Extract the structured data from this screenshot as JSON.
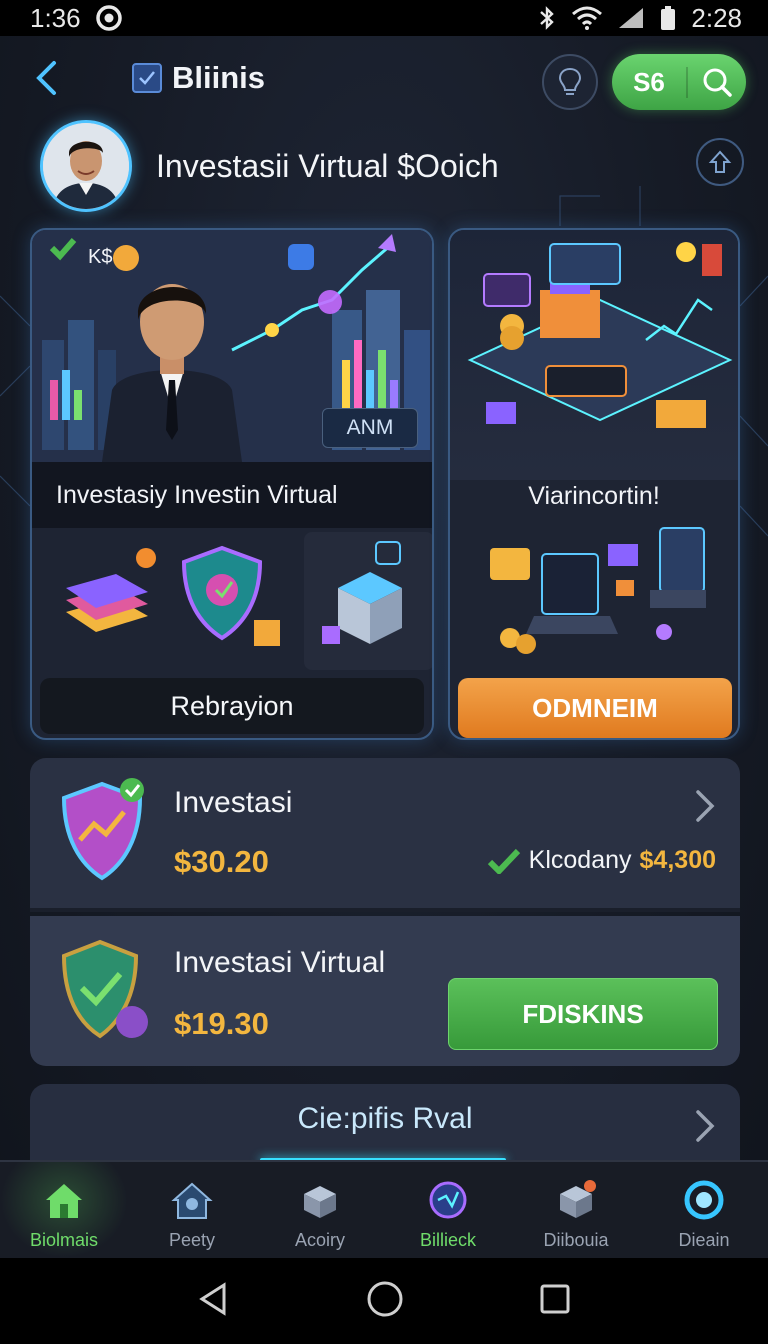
{
  "status_bar": {
    "time_left": "1:36",
    "time_right": "2:28"
  },
  "header": {
    "brand": "Bliinis",
    "badge_number": "S6"
  },
  "profile": {
    "title": "Investasii Virtual $Ooich"
  },
  "card_left": {
    "tag": "K$",
    "chip": "ANM",
    "caption": "Investasiy Investin Virtual",
    "button": "Rebrayion"
  },
  "card_right": {
    "caption": "Viarincortin!",
    "button": "ODMNEIM"
  },
  "rows": [
    {
      "title": "Investasi",
      "price": "$30.20",
      "ratio_label": "Klcodany",
      "ratio_amount": "$4,300"
    },
    {
      "title": "Investasi Virtual",
      "price": "$19.30",
      "button": "FDISKINS"
    }
  ],
  "row3": {
    "label": "Cie:pifis Rval"
  },
  "tabs": [
    {
      "label": "Biolmais"
    },
    {
      "label": "Peety"
    },
    {
      "label": "Acoiry"
    },
    {
      "label": "Billieck"
    },
    {
      "label": "Diibouia"
    },
    {
      "label": "Dieain"
    }
  ],
  "colors": {
    "accent_green": "#4cba50",
    "accent_orange": "#e8862c",
    "price_gold": "#f3b63f",
    "glow_cyan": "#37e0ff"
  }
}
